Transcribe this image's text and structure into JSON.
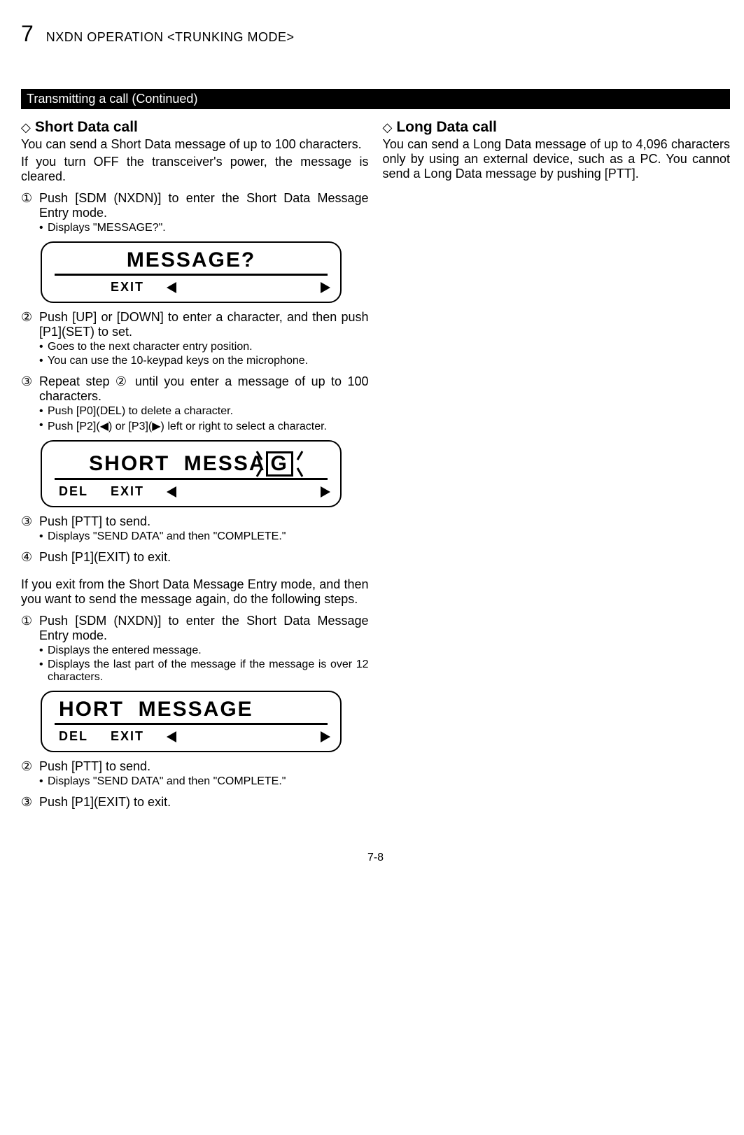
{
  "header": {
    "section_number": "7",
    "section_title": "NXDN OPERATION <TRUNKING MODE>"
  },
  "bar": "Transmitting a call (Continued)",
  "left": {
    "diamond": "◇",
    "title": "Short Data call",
    "intro1": "You can send a Short Data message of up to 100 characters.",
    "intro2": "If you turn OFF the transceiver's power, the message is cleared.",
    "s1_num": "①",
    "s1_text": "Push [SDM (NXDN)] to enter the Short Data Message Entry mode.",
    "s1_b1": "Displays \"MESSAGE?\".",
    "lcd1": {
      "top": "MESSAGE?",
      "exit": "EXIT"
    },
    "s2_num": "②",
    "s2_text": "Push [UP] or [DOWN] to enter a character, and then push [P1](SET) to set.",
    "s2_b1": "Goes to the next character entry position.",
    "s2_b2": "You can use the 10-keypad keys on the microphone.",
    "s3_num": "③",
    "s3_text_a": "Repeat step ",
    "s3_text_ref": "②",
    "s3_text_b": " until you enter a message of up to 100 characters.",
    "s3_b1": "Push [P0](DEL) to delete a character.",
    "s3_b2": "Push [P2](◀) or [P3](▶) left or right to select a character.",
    "lcd2": {
      "prefix": "SHORT  MESSA",
      "cursor": "G",
      "del": "DEL",
      "exit": "EXIT"
    },
    "s3b_num": "③",
    "s3b_text": "Push [PTT] to send.",
    "s3b_b1": "Displays \"SEND DATA\" and then \"COMPLETE.\"",
    "s4_num": "④",
    "s4_text": "Push [P1](EXIT) to exit.",
    "resend_intro": "If you exit from the Short Data Message Entry mode, and then you want to send the message again, do the following steps.",
    "r1_num": "①",
    "r1_text": "Push [SDM (NXDN)] to enter the Short Data Message Entry mode.",
    "r1_b1": "Displays the entered message.",
    "r1_b2": "Displays the last part of the message if the message is over 12 characters.",
    "lcd3": {
      "top": "HORT  MESSAGE",
      "del": "DEL",
      "exit": "EXIT"
    },
    "r2_num": "②",
    "r2_text": "Push [PTT] to send.",
    "r2_b1": "Displays \"SEND DATA\" and then \"COMPLETE.\"",
    "r3_num": "③",
    "r3_text": "Push [P1](EXIT) to exit."
  },
  "right": {
    "diamond": "◇",
    "title": "Long Data call",
    "para": "You can send a Long Data message of up to 4,096 characters only by using an external device, such as a PC. You cannot send a Long Data message by pushing [PTT]."
  },
  "footer": "7-8"
}
